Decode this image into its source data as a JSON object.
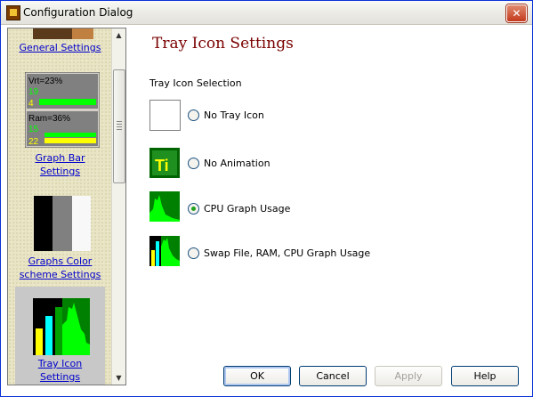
{
  "window": {
    "title": "Configuration Dialog"
  },
  "sidebar": {
    "items": [
      {
        "label": "General Settings"
      },
      {
        "label_line1": "Graph Bar",
        "label_line2": "Settings",
        "preview": {
          "top": {
            "label": "Vrt=23%",
            "n1": "19",
            "n2": "4"
          },
          "bottom": {
            "label": "Ram=36%",
            "n1": "15",
            "n2": "22"
          }
        }
      },
      {
        "label_line1": "Graphs Color",
        "label_line2": "scheme Settings"
      },
      {
        "label_line1": "Tray Icon",
        "label_line2": "Settings"
      }
    ]
  },
  "main": {
    "title": "Tray Icon Settings",
    "section_label": "Tray Icon Selection",
    "options": [
      {
        "label": "No Tray Icon",
        "checked": false
      },
      {
        "label": "No Animation",
        "checked": false,
        "icon_text": "Ti"
      },
      {
        "label": "CPU Graph Usage",
        "checked": true
      },
      {
        "label": "Swap File, RAM, CPU Graph Usage",
        "checked": false
      }
    ]
  },
  "buttons": {
    "ok": "OK",
    "cancel": "Cancel",
    "apply": "Apply",
    "help": "Help"
  },
  "colors": {
    "accent_title": "#7a0000",
    "link": "#0000cc",
    "graph_green": "#00ff00",
    "graph_bg": "#008000"
  }
}
